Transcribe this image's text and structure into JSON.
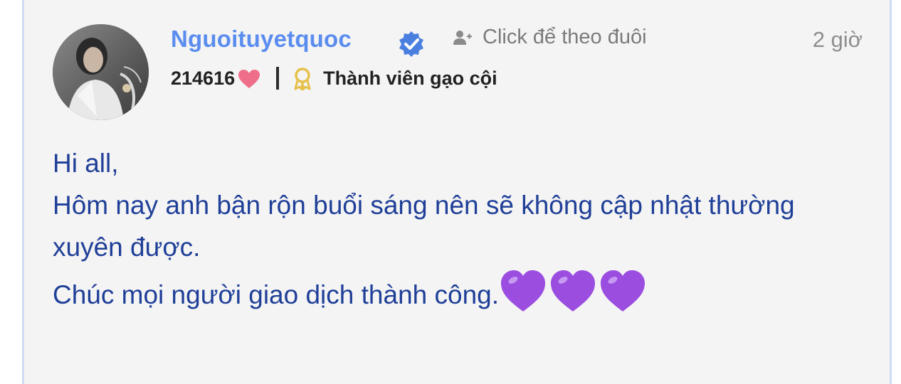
{
  "post": {
    "author": {
      "username": "Nguoituyetquoc",
      "verified": true,
      "avatar": "avatar-photo",
      "points": "214616",
      "rank_label": "Thành viên gạo cội"
    },
    "follow_label": "Click để theo đuôi",
    "time_ago": "2 giờ",
    "body": {
      "line1": "Hi all,",
      "line2": "Hôm nay anh bận rộn buổi sáng nên sẽ không cập nhật thường xuyên được.",
      "line3": "Chúc mọi người giao dịch thành công.",
      "emoji_count": 3
    }
  },
  "icons": {
    "verified": "check-badge-icon",
    "follow": "add-user-icon",
    "points": "heart-icon",
    "rank": "award-ribbon-icon",
    "emoji": "purple-heart-emoji"
  },
  "colors": {
    "username": "#5b8def",
    "body_text": "#1f3f98",
    "heart": "#ef6f8a",
    "purple_heart": "#9b4de0",
    "award": "#e6c14a",
    "card_background": "#f4f4f4",
    "card_border": "#cfdcf5"
  }
}
